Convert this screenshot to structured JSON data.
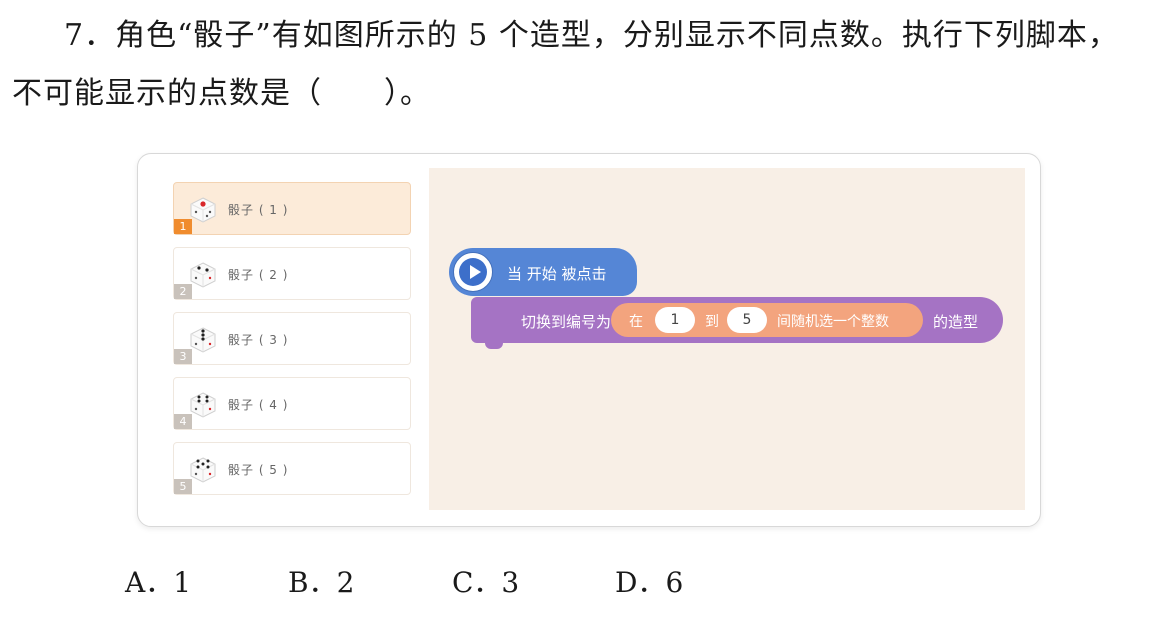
{
  "question": {
    "line1": "7．角色“骰子”有如图所示的 5 个造型，分别显示不同点数。执行下列脚本，",
    "line2": "不可能显示的点数是（　　）。"
  },
  "costumes": [
    {
      "name": "骰子 ( 1 )",
      "index": "1"
    },
    {
      "name": "骰子 ( 2 )",
      "index": "2"
    },
    {
      "name": "骰子 ( 3 )",
      "index": "3"
    },
    {
      "name": "骰子 ( 4 )",
      "index": "4"
    },
    {
      "name": "骰子 ( 5 )",
      "index": "5"
    }
  ],
  "script": {
    "hat": "当 开始 被点击",
    "switch_prefix": "切换到编号为",
    "switch_suffix": "的造型",
    "rand_in": "在",
    "rand_from": "1",
    "rand_to_word": "到",
    "rand_to": "5",
    "rand_suffix": "间随机选一个整数"
  },
  "options": [
    "A．1",
    "B．2",
    "C．3",
    "D．6"
  ],
  "colors": {
    "event_block": "#5586d6",
    "looks_block": "#a573c4",
    "operator_block": "#f3a47e",
    "selected_costume": "#fcebd9",
    "index_badge_selected": "#f08c2e"
  }
}
